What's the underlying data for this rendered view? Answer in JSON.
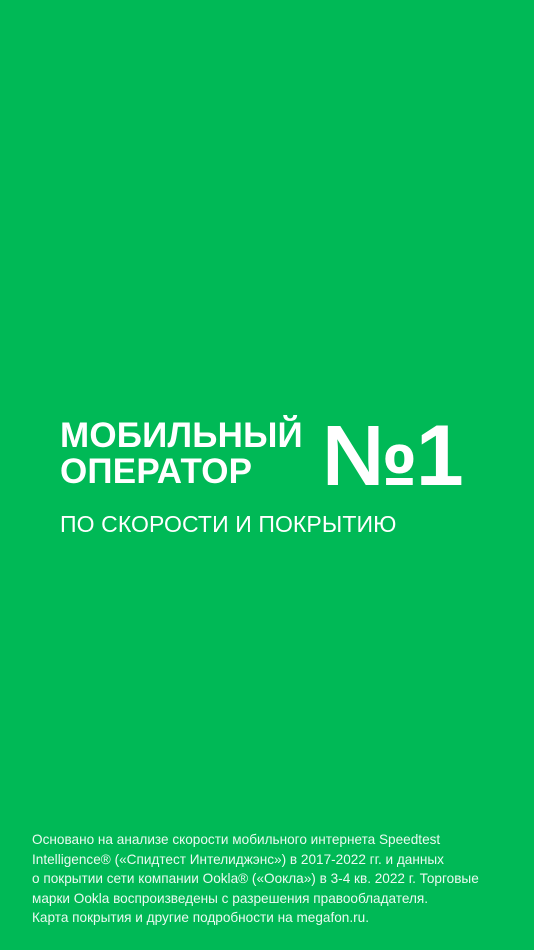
{
  "brand": {
    "background": "#00b956",
    "text_color": "#ffffff"
  },
  "hero": {
    "headline_line1": "МОБИЛЬНЫЙ",
    "headline_line2": "ОПЕРАТОР",
    "rank": "№1",
    "subline": "ПО СКОРОСТИ И ПОКРЫТИЮ"
  },
  "disclaimer": {
    "lines": [
      "Основано на анализе скорости мобильного интернета Speedtest",
      "Intelligence® («Спидтест Интелиджэнс») в 2017-2022 гг. и данных",
      "о покрытии сети компании Ookla® («Оокла») в 3-4 кв. 2022 г. Торговые",
      "марки Ookla воспроизведены с разрешения правообладателя.",
      "Карта покрытия и другие подробности на megafon.ru."
    ]
  }
}
